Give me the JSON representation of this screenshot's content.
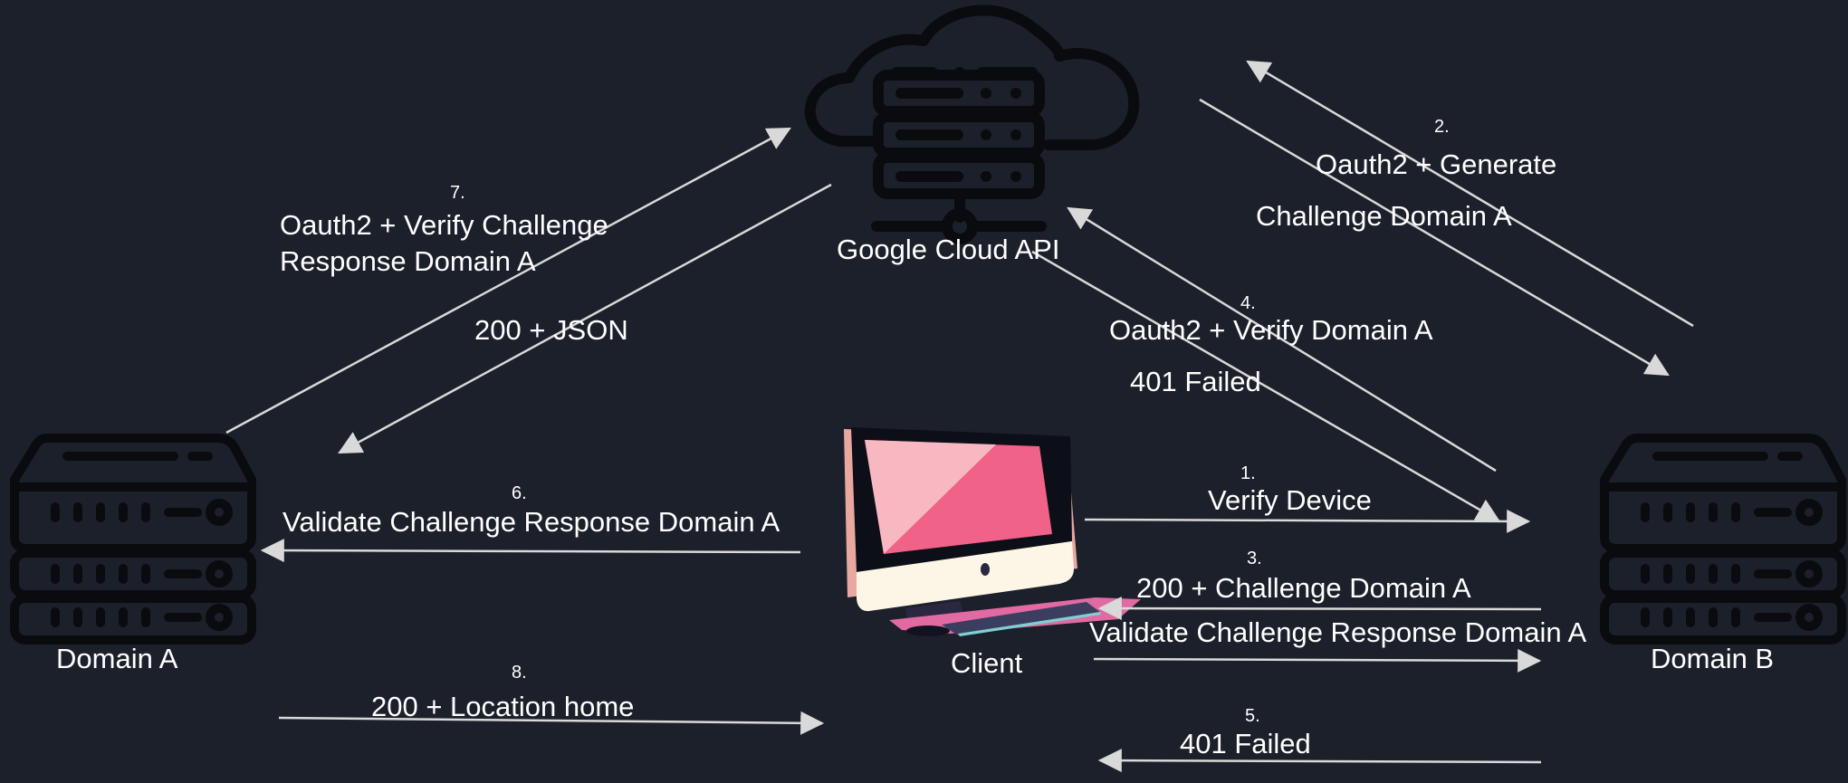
{
  "diagram": {
    "background_color": "#1c202b",
    "arrow_color": "#d9d9d9",
    "icon_stroke_color": "#0a0b0f",
    "nodes": {
      "cloud": {
        "label": "Google Cloud API",
        "icon": "cloud-server-icon"
      },
      "domain_a": {
        "label": "Domain A",
        "icon": "server-rack-icon"
      },
      "domain_b": {
        "label": "Domain B",
        "icon": "server-rack-icon"
      },
      "client": {
        "label": "Client",
        "icon": "desktop-computer-icon"
      }
    },
    "steps": [
      {
        "number": "1.",
        "label": "Verify Device",
        "from": "Client",
        "to": "Domain B"
      },
      {
        "number": "2.",
        "label_line1": "Oauth2 + Generate",
        "label_line2": "Challenge Domain A",
        "from": "Domain B",
        "to": "Google Cloud API"
      },
      {
        "number": "3.",
        "label": "200 + Challenge Domain A",
        "from": "Domain B",
        "to": "Client"
      },
      {
        "number": "4.",
        "label": "Oauth2 + Verify Domain A",
        "from": "Domain B",
        "to": "Google Cloud API"
      },
      {
        "number": "5.",
        "label": "401 Failed",
        "from": "Domain B",
        "to": "Client"
      },
      {
        "number": "6.",
        "label": "Validate Challenge Response Domain A",
        "from": "Client",
        "to": "Domain A"
      },
      {
        "number": "7.",
        "label_line1": "Oauth2 + Verify Challenge",
        "label_line2": "Response Domain A",
        "from": "Domain A",
        "to": "Google Cloud API"
      },
      {
        "number": "8.",
        "label": "200 + Location home",
        "from": "Domain A",
        "to": "Client"
      }
    ],
    "unnumbered": {
      "cloud_to_domain_a": "200 + JSON",
      "cloud_to_domain_b": "401 Failed",
      "client_to_domain_b": "Validate Challenge Response Domain A"
    }
  }
}
